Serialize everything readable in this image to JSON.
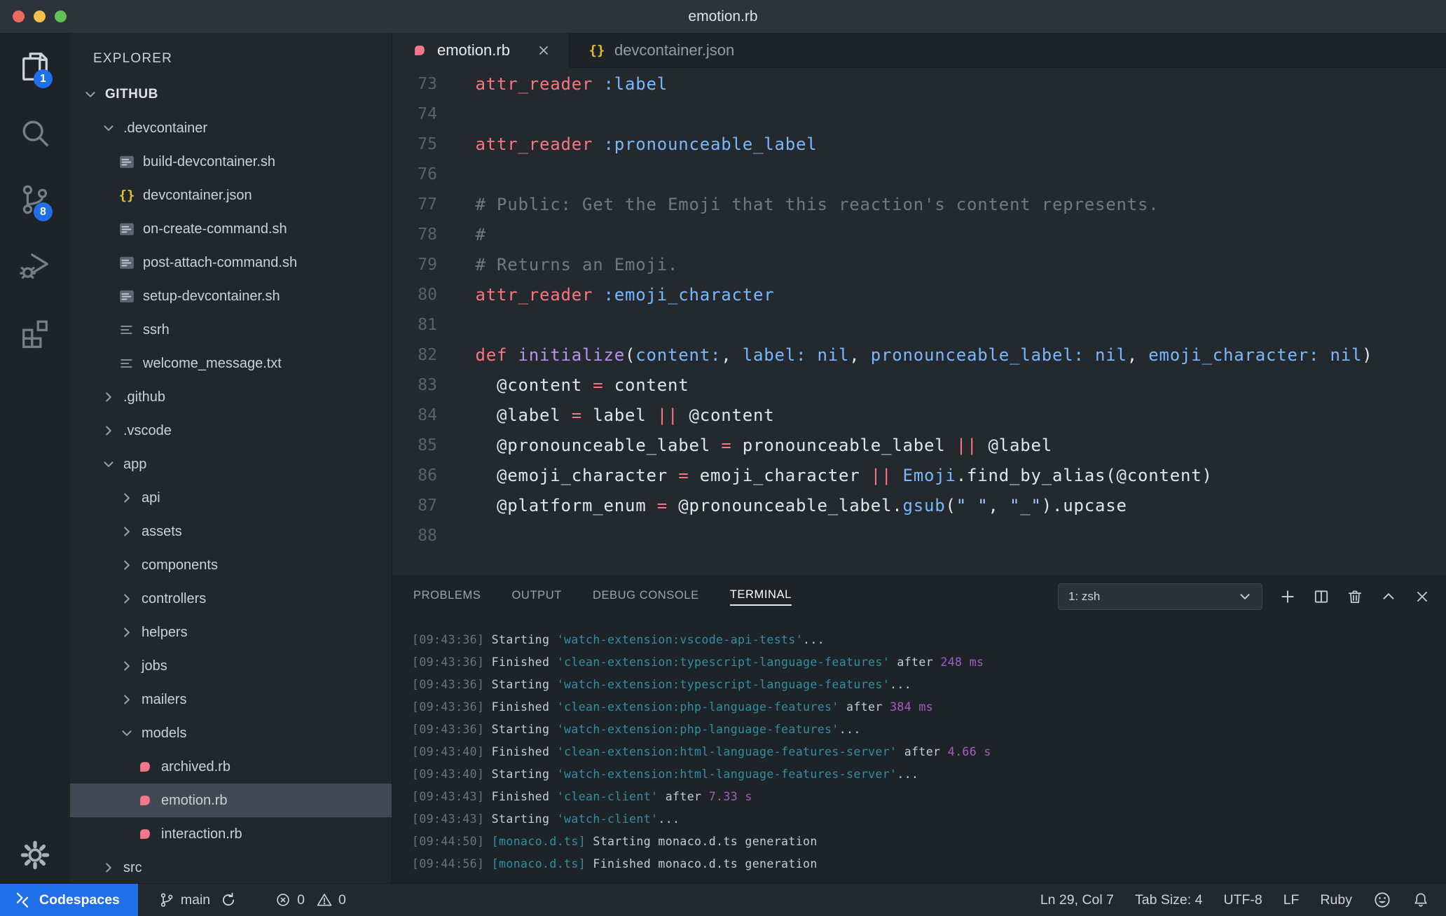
{
  "window": {
    "title": "emotion.rb"
  },
  "colors": {
    "accent_blue": "#1f6feb",
    "ruby_pink": "#f1798a",
    "json_yellow": "#dcc22f",
    "terminal_task_cyan": "#2e8fa8",
    "terminal_duration_purple": "#a65cc4",
    "traffic_red": "#ed6a5e",
    "traffic_yellow": "#f4bf4f",
    "traffic_green": "#61c554"
  },
  "activity_bar": {
    "items": [
      {
        "id": "explorer",
        "badge": "1",
        "active": true
      },
      {
        "id": "search",
        "badge": "",
        "active": false
      },
      {
        "id": "source-control",
        "badge": "8",
        "active": false
      },
      {
        "id": "run-debug",
        "badge": "",
        "active": false
      },
      {
        "id": "extensions",
        "badge": "",
        "active": false
      }
    ]
  },
  "sidebar": {
    "title": "EXPLORER",
    "tree": [
      {
        "label": "GITHUB",
        "kind": "root",
        "expanded": true,
        "indent": 0,
        "selected": false
      },
      {
        "label": ".devcontainer",
        "kind": "folder",
        "expanded": true,
        "indent": 1,
        "selected": false
      },
      {
        "label": "build-devcontainer.sh",
        "kind": "shell",
        "indent": 2,
        "selected": false
      },
      {
        "label": "devcontainer.json",
        "kind": "json",
        "indent": 2,
        "selected": false
      },
      {
        "label": "on-create-command.sh",
        "kind": "shell",
        "indent": 2,
        "selected": false
      },
      {
        "label": "post-attach-command.sh",
        "kind": "shell",
        "indent": 2,
        "selected": false
      },
      {
        "label": "setup-devcontainer.sh",
        "kind": "shell",
        "indent": 2,
        "selected": false
      },
      {
        "label": "ssrh",
        "kind": "text",
        "indent": 2,
        "selected": false
      },
      {
        "label": "welcome_message.txt",
        "kind": "text",
        "indent": 2,
        "selected": false
      },
      {
        "label": ".github",
        "kind": "folder",
        "expanded": false,
        "indent": 1,
        "selected": false
      },
      {
        "label": ".vscode",
        "kind": "folder",
        "expanded": false,
        "indent": 1,
        "selected": false
      },
      {
        "label": "app",
        "kind": "folder",
        "expanded": true,
        "indent": 1,
        "selected": false
      },
      {
        "label": "api",
        "kind": "folder",
        "expanded": false,
        "indent": 2,
        "selected": false
      },
      {
        "label": "assets",
        "kind": "folder",
        "expanded": false,
        "indent": 2,
        "selected": false
      },
      {
        "label": "components",
        "kind": "folder",
        "expanded": false,
        "indent": 2,
        "selected": false
      },
      {
        "label": "controllers",
        "kind": "folder",
        "expanded": false,
        "indent": 2,
        "selected": false
      },
      {
        "label": "helpers",
        "kind": "folder",
        "expanded": false,
        "indent": 2,
        "selected": false
      },
      {
        "label": "jobs",
        "kind": "folder",
        "expanded": false,
        "indent": 2,
        "selected": false
      },
      {
        "label": "mailers",
        "kind": "folder",
        "expanded": false,
        "indent": 2,
        "selected": false
      },
      {
        "label": "models",
        "kind": "folder",
        "expanded": true,
        "indent": 2,
        "selected": false
      },
      {
        "label": "archived.rb",
        "kind": "ruby",
        "indent": 3,
        "selected": false
      },
      {
        "label": "emotion.rb",
        "kind": "ruby",
        "indent": 3,
        "selected": true
      },
      {
        "label": "interaction.rb",
        "kind": "ruby",
        "indent": 3,
        "selected": false
      },
      {
        "label": "src",
        "kind": "folder",
        "expanded": false,
        "indent": 1,
        "selected": false
      }
    ]
  },
  "tabs": [
    {
      "label": "emotion.rb",
      "icon": "ruby",
      "active": true,
      "closable": true
    },
    {
      "label": "devcontainer.json",
      "icon": "json",
      "active": false,
      "closable": false
    }
  ],
  "editor": {
    "lines": [
      {
        "num": "73",
        "segs": [
          [
            "p",
            "  "
          ],
          [
            "k",
            "attr_reader"
          ],
          [
            "p",
            " "
          ],
          [
            "b",
            ":label"
          ]
        ]
      },
      {
        "num": "74",
        "segs": []
      },
      {
        "num": "75",
        "segs": [
          [
            "p",
            "  "
          ],
          [
            "k",
            "attr_reader"
          ],
          [
            "p",
            " "
          ],
          [
            "b",
            ":pronounceable_label"
          ]
        ]
      },
      {
        "num": "76",
        "segs": []
      },
      {
        "num": "77",
        "segs": [
          [
            "c",
            "  # Public: Get the Emoji that this reaction's content represents."
          ]
        ]
      },
      {
        "num": "78",
        "segs": [
          [
            "c",
            "  #"
          ]
        ]
      },
      {
        "num": "79",
        "segs": [
          [
            "c",
            "  # Returns an Emoji."
          ]
        ]
      },
      {
        "num": "80",
        "segs": [
          [
            "p",
            "  "
          ],
          [
            "k",
            "attr_reader"
          ],
          [
            "p",
            " "
          ],
          [
            "b",
            ":emoji_character"
          ]
        ]
      },
      {
        "num": "81",
        "segs": []
      },
      {
        "num": "82",
        "segs": [
          [
            "p",
            "  "
          ],
          [
            "k",
            "def"
          ],
          [
            "p",
            " "
          ],
          [
            "f",
            "initialize"
          ],
          [
            "p",
            "("
          ],
          [
            "b",
            "content:"
          ],
          [
            "p",
            ", "
          ],
          [
            "b",
            "label: nil"
          ],
          [
            "p",
            ", "
          ],
          [
            "b",
            "pronounceable_label: nil"
          ],
          [
            "p",
            ", "
          ],
          [
            "b",
            "emoji_character: nil"
          ],
          [
            "p",
            ")"
          ]
        ]
      },
      {
        "num": "83",
        "segs": [
          [
            "p",
            "    @content "
          ],
          [
            "k",
            "="
          ],
          [
            "p",
            " content"
          ]
        ]
      },
      {
        "num": "84",
        "segs": [
          [
            "p",
            "    @label "
          ],
          [
            "k",
            "="
          ],
          [
            "p",
            " label "
          ],
          [
            "k",
            "||"
          ],
          [
            "p",
            " @content"
          ]
        ]
      },
      {
        "num": "85",
        "segs": [
          [
            "p",
            "    @pronounceable_label "
          ],
          [
            "k",
            "="
          ],
          [
            "p",
            " pronounceable_label "
          ],
          [
            "k",
            "||"
          ],
          [
            "p",
            " @label"
          ]
        ]
      },
      {
        "num": "86",
        "segs": [
          [
            "p",
            "    @emoji_character "
          ],
          [
            "k",
            "="
          ],
          [
            "p",
            " emoji_character "
          ],
          [
            "k",
            "||"
          ],
          [
            "p",
            " "
          ],
          [
            "b",
            "Emoji"
          ],
          [
            "p",
            ".find_by_alias(@content)"
          ]
        ]
      },
      {
        "num": "87",
        "segs": [
          [
            "p",
            "    @platform_enum "
          ],
          [
            "k",
            "="
          ],
          [
            "p",
            " @pronounceable_label."
          ],
          [
            "b",
            "gsub"
          ],
          [
            "p",
            "("
          ],
          [
            "s",
            "\" \""
          ],
          [
            "p",
            ", "
          ],
          [
            "s",
            "\"_\""
          ],
          [
            "p",
            ")"
          ],
          [
            "p",
            ".upcase"
          ]
        ]
      },
      {
        "num": "88",
        "segs": []
      }
    ]
  },
  "panel": {
    "tabs": [
      {
        "label": "PROBLEMS",
        "active": false
      },
      {
        "label": "OUTPUT",
        "active": false
      },
      {
        "label": "DEBUG CONSOLE",
        "active": false
      },
      {
        "label": "TERMINAL",
        "active": true
      }
    ],
    "terminal_select": "1: zsh",
    "terminal_lines": [
      [
        [
          "t",
          "[09:43:36]"
        ],
        [
          "tp",
          " Starting "
        ],
        [
          "y",
          "'watch-extension:vscode-api-tests'"
        ],
        [
          "tp",
          "..."
        ]
      ],
      [
        [
          "t",
          "[09:43:36]"
        ],
        [
          "tp",
          " Finished "
        ],
        [
          "y",
          "'clean-extension:typescript-language-features'"
        ],
        [
          "tp",
          " after "
        ],
        [
          "u",
          "248 ms"
        ]
      ],
      [
        [
          "t",
          "[09:43:36]"
        ],
        [
          "tp",
          " Starting "
        ],
        [
          "y",
          "'watch-extension:typescript-language-features'"
        ],
        [
          "tp",
          "..."
        ]
      ],
      [
        [
          "t",
          "[09:43:36]"
        ],
        [
          "tp",
          " Finished "
        ],
        [
          "y",
          "'clean-extension:php-language-features'"
        ],
        [
          "tp",
          " after "
        ],
        [
          "u",
          "384 ms"
        ]
      ],
      [
        [
          "t",
          "[09:43:36]"
        ],
        [
          "tp",
          " Starting "
        ],
        [
          "y",
          "'watch-extension:php-language-features'"
        ],
        [
          "tp",
          "..."
        ]
      ],
      [
        [
          "t",
          "[09:43:40]"
        ],
        [
          "tp",
          " Finished "
        ],
        [
          "y",
          "'clean-extension:html-language-features-server'"
        ],
        [
          "tp",
          " after "
        ],
        [
          "u",
          "4.66 s"
        ]
      ],
      [
        [
          "t",
          "[09:43:40]"
        ],
        [
          "tp",
          " Starting "
        ],
        [
          "y",
          "'watch-extension:html-language-features-server'"
        ],
        [
          "tp",
          "..."
        ]
      ],
      [
        [
          "t",
          "[09:43:43]"
        ],
        [
          "tp",
          " Finished "
        ],
        [
          "y",
          "'clean-client'"
        ],
        [
          "tp",
          " after "
        ],
        [
          "u",
          "7.33 s"
        ]
      ],
      [
        [
          "t",
          "[09:43:43]"
        ],
        [
          "tp",
          " Starting "
        ],
        [
          "y",
          "'watch-client'"
        ],
        [
          "tp",
          "..."
        ]
      ],
      [
        [
          "t",
          "[09:44:50]"
        ],
        [
          "tp",
          " "
        ],
        [
          "y",
          "[monaco.d.ts]"
        ],
        [
          "tp",
          " Starting monaco.d.ts generation"
        ]
      ],
      [
        [
          "t",
          "[09:44:56]"
        ],
        [
          "tp",
          " "
        ],
        [
          "y",
          "[monaco.d.ts]"
        ],
        [
          "tp",
          " Finished monaco.d.ts generation"
        ]
      ]
    ]
  },
  "status_bar": {
    "codespaces": "Codespaces",
    "branch": "main",
    "errors": "0",
    "warnings": "0",
    "right_items": [
      {
        "id": "line-col",
        "label": "Ln 29, Col 7"
      },
      {
        "id": "tab-size",
        "label": "Tab Size: 4"
      },
      {
        "id": "encoding",
        "label": "UTF-8"
      },
      {
        "id": "eol",
        "label": "LF"
      },
      {
        "id": "language",
        "label": "Ruby"
      }
    ]
  }
}
